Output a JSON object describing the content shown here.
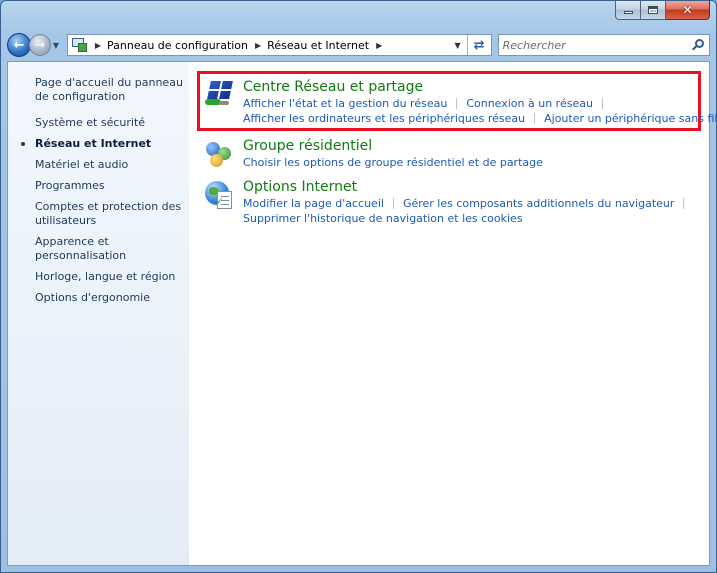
{
  "window": {
    "caption_buttons": {
      "minimize": "minimize",
      "maximize": "maximize",
      "close": "close"
    }
  },
  "address_bar": {
    "breadcrumbs": [
      "Panneau de configuration",
      "Réseau et Internet"
    ]
  },
  "search": {
    "placeholder": "Rechercher"
  },
  "sidebar": {
    "home": "Page d'accueil du panneau de configuration",
    "items": [
      "Système et sécurité",
      "Réseau et Internet",
      "Matériel et audio",
      "Programmes",
      "Comptes et protection des utilisateurs",
      "Apparence et personnalisation",
      "Horloge, langue et région",
      "Options d'ergonomie"
    ],
    "active_index": 1
  },
  "categories": [
    {
      "title": "Centre Réseau et partage",
      "icon": "network-center-icon",
      "links": [
        "Afficher l'état et la gestion du réseau",
        "Connexion à un réseau",
        "Afficher les ordinateurs et les périphériques réseau",
        "Ajouter un périphérique sans fil au réseau"
      ]
    },
    {
      "title": "Groupe résidentiel",
      "icon": "homegroup-icon",
      "links": [
        "Choisir les options de groupe résidentiel et de partage"
      ]
    },
    {
      "title": "Options Internet",
      "icon": "internet-options-icon",
      "links": [
        "Modifier la page d'accueil",
        "Gérer les composants additionnels du navigateur",
        "Supprimer l'historique de navigation et les cookies"
      ]
    }
  ],
  "colors": {
    "highlight_border": "#e81222",
    "category_title": "#117a11",
    "link": "#1e5ab4"
  }
}
